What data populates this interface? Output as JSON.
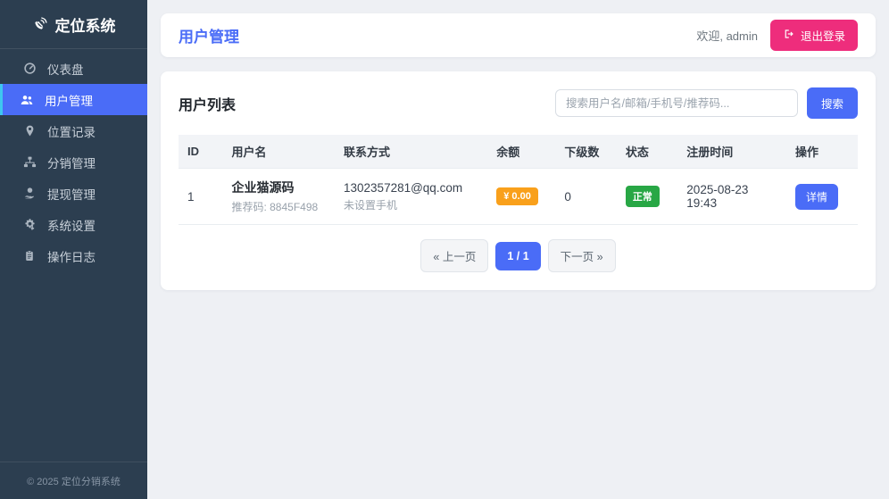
{
  "app": {
    "title": "定位系统",
    "footer": "© 2025 定位分销系统"
  },
  "colors": {
    "sidebar_bg": "#2c3e50",
    "accent_blue": "#4a6cf7",
    "active_border_cyan": "#3ec6f0",
    "logout_pink": "#ee2d7c",
    "balance_orange": "#f9a01b",
    "status_green": "#28a745",
    "page_bg": "#eef0f4"
  },
  "sidebar": {
    "items": [
      {
        "label": "仪表盘",
        "icon": "gauge-icon",
        "active": false
      },
      {
        "label": "用户管理",
        "icon": "users-icon",
        "active": true
      },
      {
        "label": "位置记录",
        "icon": "map-marker-icon",
        "active": false
      },
      {
        "label": "分销管理",
        "icon": "sitemap-icon",
        "active": false
      },
      {
        "label": "提现管理",
        "icon": "hand-holding-money-icon",
        "active": false
      },
      {
        "label": "系统设置",
        "icon": "gears-icon",
        "active": false
      },
      {
        "label": "操作日志",
        "icon": "clipboard-icon",
        "active": false
      }
    ]
  },
  "header": {
    "title": "用户管理",
    "welcome": "欢迎, admin",
    "logout_label": "退出登录"
  },
  "content": {
    "card_title": "用户列表",
    "search": {
      "placeholder": "搜索用户名/邮箱/手机号/推荐码...",
      "button_label": "搜索"
    },
    "table": {
      "columns": [
        "ID",
        "用户名",
        "联系方式",
        "余额",
        "下级数",
        "状态",
        "注册时间",
        "操作"
      ],
      "rows": [
        {
          "id": "1",
          "username": "企业猫源码",
          "referral": "推荐码: 8845F498",
          "email": "1302357281@qq.com",
          "phone": "未设置手机",
          "balance": "¥ 0.00",
          "subordinates": "0",
          "status": "正常",
          "registered": "2025-08-23 19:43",
          "action_label": "详情"
        }
      ]
    },
    "pagination": {
      "prev": "« 上一页",
      "current": "1 / 1",
      "next": "下一页 »"
    }
  }
}
